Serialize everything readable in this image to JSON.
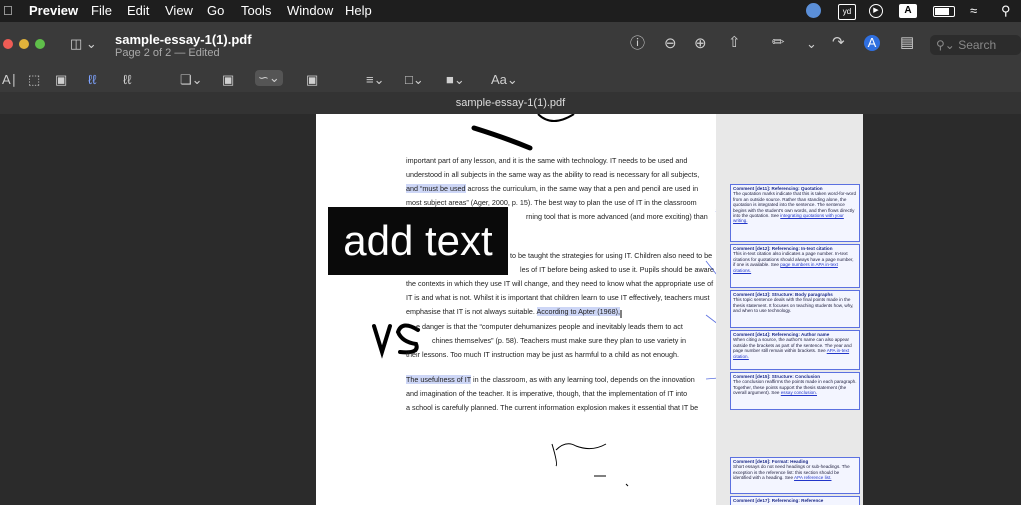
{
  "menubar": {
    "app": "Preview",
    "items": [
      "File",
      "Edit",
      "View",
      "Go",
      "Tools",
      "Window",
      "Help"
    ],
    "status": {
      "yd": "yd",
      "a": "A"
    }
  },
  "toolbar": {
    "doc_title": "sample-essay-1(1).pdf",
    "doc_subtitle": "Page 2 of 2 — Edited",
    "search_placeholder": "Search",
    "text_style_label": "Aa"
  },
  "window_title": "sample-essay-1(1).pdf",
  "document": {
    "lines": [
      {
        "text": "important part of any lesson, and it is the same with technology. IT needs to be used and",
        "hl": ""
      },
      {
        "text": "understood in all subjects in the same way as the ability to read is necessary for all subjects,",
        "hl": ""
      },
      {
        "hl": "and “must be used",
        "text": " across the curriculum, in the same way that a pen and pencil are used in"
      },
      {
        "hl": "",
        "text": "most subject areas” (Ager, 2000, p. 15). The best way to plan the use of IT in the classroom"
      },
      {
        "text": "rning tool that is more advanced (and more exciting) than",
        "hl": ""
      },
      {
        "text": "",
        "hl": ""
      },
      {
        "hl": "",
        "text": "to be taught the strategies for using IT. Children also need to be"
      },
      {
        "text": "les of IT before being asked to use it. Pupils should be aware that",
        "hl": ""
      },
      {
        "text": "the contexts in which they use IT will change, and they need to know what the appropriate use of",
        "hl": ""
      },
      {
        "text": "IT is and what is not. Whilst it is important that children learn to use IT effectively, teachers must",
        "hl": ""
      },
      {
        "text": "emphasise that IT is not always suitable. ",
        "hl": "According to Apter (1968),"
      },
      {
        "text": "e danger is that the “computer dehumanizes people and inevitably leads them to act",
        "hl": ""
      },
      {
        "text": "chines themselves” (p. 58). Teachers must make sure they plan to use variety in",
        "hl": ""
      },
      {
        "text": "their lessons. Too much IT instruction may be just as harmful to a child as not enough.",
        "hl": ""
      },
      {
        "text": "",
        "hl": ""
      },
      {
        "hl": "The usefulness of IT",
        "text": " in the classroom, as with any learning tool, depends on the innovation"
      },
      {
        "text": "and imagination of the teacher. It is imperative, though, that the implementation of IT into",
        "hl": ""
      },
      {
        "text": "a school is carefully planned. The current information explosion makes it essential that IT be",
        "hl": ""
      }
    ],
    "overlay_text": "add text"
  },
  "comments": [
    {
      "title": "Comment [de11]: Referencing: Quotation",
      "body": "The quotation marks indicate that this is taken word-for-word from an outside source. Rather than standing alone, the quotation is integrated into the sentence. The sentence begins with the student's own words, and then flows directly into the quotation. See",
      "link": "integrating quotations with your writing."
    },
    {
      "title": "Comment [de12]: Referencing: In-text citation",
      "body": "This in-text citation also indicates a page number. In-text citations for quotations should always have a page number, if one is available. See",
      "link": "page numbers in APA in-text citations."
    },
    {
      "title": "Comment [de13]: Structure: Body paragraphs",
      "body": "This topic sentence deals with the final points made in the thesis statement. It focuses on teaching students how, why, and when to use technology.",
      "link": ""
    },
    {
      "title": "Comment [de14]: Referencing: Author name",
      "body": "When citing a source, the author's name can also appear outside the brackets as part of the sentence. The year and page number still remain within brackets. See",
      "link": "APA in-text citation."
    },
    {
      "title": "Comment [de15]: Structure: Conclusion",
      "body": "The conclusion reaffirms the points made in each paragraph. Together, these points support the thesis statement (the overall argument). See",
      "link": "essay conclusion."
    },
    {
      "title": "Comment [de16]: Format: Heading",
      "body": "Short essays do not need headings or sub-headings. The exception is the reference list: this section should be identified with a heading. See",
      "link": "APA reference list."
    },
    {
      "title": "Comment [de17]: Referencing: Reference",
      "body": "",
      "link": ""
    }
  ]
}
